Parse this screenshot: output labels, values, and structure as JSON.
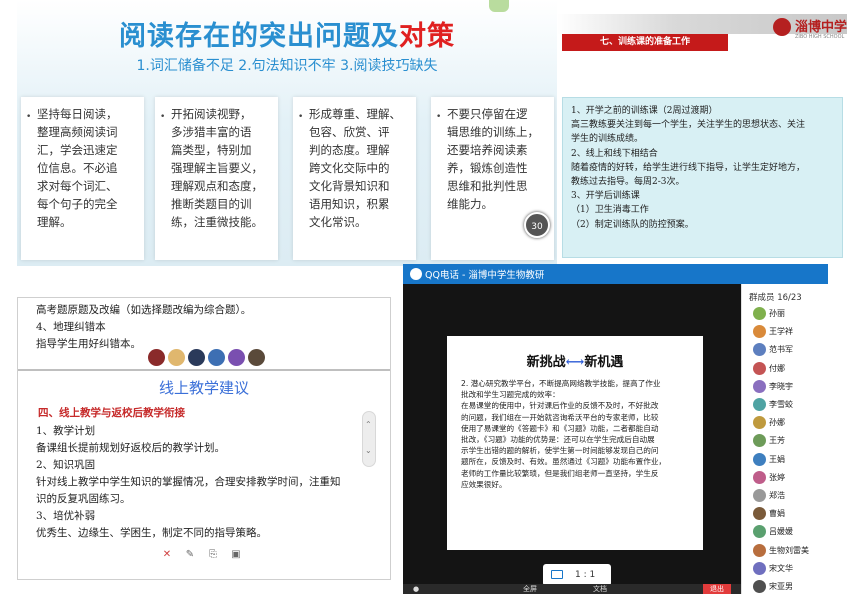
{
  "reading_slide": {
    "title_main": "阅读存在的突出问题及",
    "title_highlight": "对策",
    "subtitle": "1.词汇储备不足  2.句法知识不牢  3.阅读技巧缺失",
    "bullet": "•",
    "cards": [
      {
        "lines": [
          "坚持每日阅读，",
          "整理高频阅读词",
          "汇，学会迅速定",
          "位信息。不必追",
          "求对每个词汇、",
          "每个句子的完全",
          "理解。"
        ]
      },
      {
        "lines": [
          "开拓阅读视野，",
          "多涉猎丰富的语",
          "篇类型，特别加",
          "强理解主旨要义，",
          "理解观点和态度，",
          "推断类题目的训",
          "练，注重微技能。"
        ]
      },
      {
        "lines": [
          "形成尊重、理解、",
          "包容、欣赏、评",
          "判的态度。理解",
          "跨文化交际中的",
          "文化背景知识和",
          "语用知识，积累",
          "文化常识。"
        ]
      },
      {
        "lines": [
          "不要只停留在逻",
          "辑思维的训练上，",
          "还要培养阅读素",
          "养，锻炼创造性",
          "思维和批判性思",
          "维能力。"
        ]
      }
    ],
    "chip_label": "30"
  },
  "training_slide": {
    "school_name": "淄博中学",
    "school_sub": "ZIBO HIGH SCHOOL",
    "banner": "七、训练课的准备工作",
    "lines": [
      "1、开学之前的训练课（2周过渡期）",
      "    高三教练要关注到每一个学生，关注学生的思想状态、关注",
      "学生的训练成绩。",
      "2、线上和线下相结合",
      "    随着疫情的好转，给学生进行线下指导，让学生定好地方，",
      "教练过去指导。每周2-3次。",
      "3、开学后训练课",
      "  （1）卫生消毒工作",
      "  （2）制定训练队的防控预案。"
    ]
  },
  "online_doc": {
    "top_lines": [
      "      高考题原题及改编（如选择题改编为综合题）。",
      "  4、地理纠错本",
      "      指导学生用好纠错本。"
    ],
    "heading": "线上教学建议",
    "red_title": "四、线上教学与返校后教学衔接",
    "body_lines": [
      "1、教学计划",
      "    备课组长提前规划好返校后的教学计划。",
      "2、知识巩固",
      "    针对线上教学中学生知识的掌握情况，合理安排教学时间，注重知",
      "识的反复巩固练习。",
      "3、培优补弱",
      "    优秀生、边缘生、学困生，制定不同的指导策略。"
    ],
    "scroll_up": "⌃",
    "scroll_down": "⌄",
    "bottom_icons": [
      "✕",
      "✎",
      "⎘",
      "▣"
    ]
  },
  "qq_call": {
    "window_title": "QQ电话 - 淄博中学生物教研",
    "shared_heading_left": "新挑战",
    "shared_heading_arrow": "⟷",
    "shared_heading_right": "新机遇",
    "shared_body": [
      "2. 潜心研究教学平台，不断提高网络教学技能，提高了作业",
      "批改和学生习题完成的效率：",
      "在易课堂的使用中，针对课后作业的反馈不及时，不好批改",
      "的问题，我们组在一开始就咨询希沃平台的专家老师，比较",
      "使用了易课堂的《答题卡》和《习题》功能，二者都能自动",
      "批改，《习题》功能的优势是：还可以在学生完成后自动展",
      "示学生出错的题的解析，使学生第一时间能够发现自己的问",
      "题所在，反馈及时、有效。虽然通过《习题》功能布置作业，",
      "老师的工作量比较繁琐，但是我们组老师一直坚持，学生反",
      "应效果很好。"
    ],
    "ratio": "1 : 1",
    "controls": {
      "fullscreen": "全屏",
      "doc": "文档",
      "exit": "退出"
    },
    "members_header": "群成员 16/23",
    "members": [
      "孙丽",
      "王学祥",
      "范书军",
      "付娜",
      "李晓宇",
      "李雪蛟",
      "孙娜",
      "王芳",
      "王娟",
      "张婷",
      "郑浩",
      "曹娟",
      "吕媛媛",
      "生物刘雷美",
      "宋文华",
      "宋亚男"
    ],
    "member_colors": [
      "#7fb04d",
      "#d98a3a",
      "#5d7fbf",
      "#c45454",
      "#8a6fbf",
      "#4fa3a3",
      "#bf9a3e",
      "#6d9b59",
      "#3e7fbf",
      "#bf5d8a",
      "#999999",
      "#7a5a3a",
      "#5aa06f",
      "#b86e3e",
      "#6f6fbf",
      "#4f4f4f"
    ]
  }
}
